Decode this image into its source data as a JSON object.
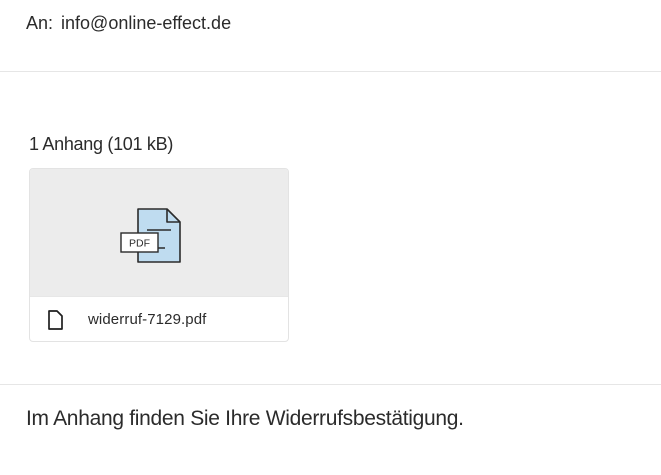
{
  "recipient": {
    "label": "An:",
    "email": "info@online-effect.de"
  },
  "attachments": {
    "heading": "1 Anhang (101 kB)",
    "items": [
      {
        "file_name": "widerruf-7129.pdf",
        "preview_badge": "PDF",
        "preview_icon": "pdf-document-icon",
        "row_icon": "file-icon"
      }
    ]
  },
  "message": {
    "body": "Im Anhang finden Sie Ihre Widerrufsbestätigung."
  },
  "colors": {
    "preview_background": "#ececec",
    "pdf_icon_fill": "#bfdcf0",
    "text": "#2b2b2b",
    "divider": "#e6e6e6"
  }
}
